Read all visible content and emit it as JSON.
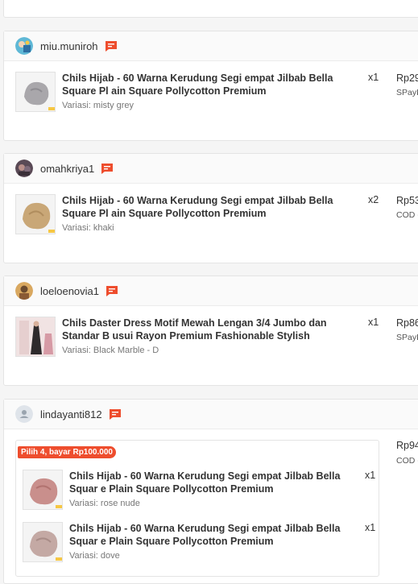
{
  "orders": [
    {
      "username": "miu.muniroh",
      "items": [
        {
          "title": "Chils Hijab - 60 Warna Kerudung Segi empat Jilbab Bella Square Pl ain Square Pollycotton Premium",
          "qty": "x1",
          "variant": "Variasi: misty grey"
        }
      ],
      "price": "Rp29",
      "payment": "SPayL"
    },
    {
      "username": "omahkriya1",
      "items": [
        {
          "title": "Chils Hijab - 60 Warna Kerudung Segi empat Jilbab Bella Square Pl ain Square Pollycotton Premium",
          "qty": "x2",
          "variant": "Variasi: khaki"
        }
      ],
      "price": "Rp53",
      "payment": "COD ("
    },
    {
      "username": "loeloenovia1",
      "items": [
        {
          "title": "Chils Daster Dress Motif Mewah Lengan 3/4 Jumbo dan Standar B usui Rayon Premium Fashionable Stylish",
          "qty": "x1",
          "variant": "Variasi: Black Marble - D"
        }
      ],
      "price": "Rp86",
      "payment": "SPayL"
    },
    {
      "username": "lindayanti812",
      "promo": "Pilih 4, bayar Rp100.000",
      "items": [
        {
          "title": "Chils Hijab - 60 Warna Kerudung Segi empat Jilbab Bella Squar e Plain Square Pollycotton Premium",
          "qty": "x1",
          "variant": "Variasi: rose nude"
        },
        {
          "title": "Chils Hijab - 60 Warna Kerudung Segi empat Jilbab Bella Squar e Plain Square Pollycotton Premium",
          "qty": "x1",
          "variant": "Variasi: dove"
        }
      ],
      "price": "Rp94",
      "payment": "COD ("
    }
  ],
  "icons": {
    "chat": "chat-icon",
    "avatar_default": "user-icon"
  },
  "colors": {
    "accent": "#ee4d2d"
  }
}
